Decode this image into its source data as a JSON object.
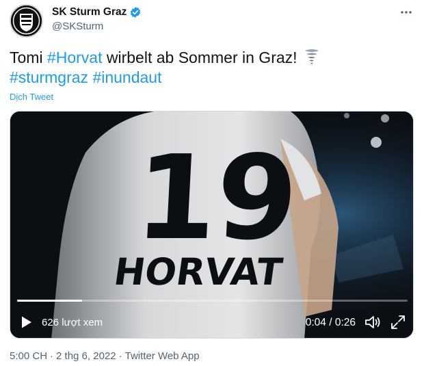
{
  "account": {
    "display_name": "SK Sturm Graz",
    "handle": "@SKSturm",
    "verified_icon": "verified-badge-icon",
    "avatar_icon": "club-crest-icon"
  },
  "more_icon": "more-options-icon",
  "tweet": {
    "word_1": "Tomi ",
    "hashtag_1": "#Horvat",
    "word_2": " wirbelt ab Sommer in Graz!",
    "emoji_icon": "tornado-emoji-icon",
    "hashtag_2": "#sturmgraz",
    "hashtag_3": "#inundaut"
  },
  "translate_label": "Dịch Tweet",
  "video": {
    "jersey_number": "19",
    "jersey_name": "HORVAT",
    "views": "626 lượt xem",
    "time": "0:04 / 0:26",
    "progress_fraction": 0.167,
    "icons": [
      "play-icon",
      "volume-icon",
      "fullscreen-icon"
    ]
  },
  "meta": {
    "time": "5:00 CH",
    "separator": "·",
    "date": "2 thg 6, 2022",
    "source": "Twitter Web App"
  },
  "colors": {
    "link": "#1d9bf0",
    "secondary_text": "#536471",
    "primary_text": "#0f1419"
  }
}
